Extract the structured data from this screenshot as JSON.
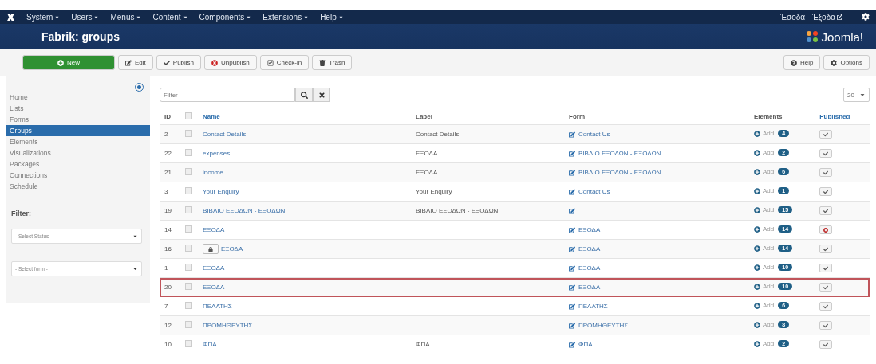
{
  "navbar": {
    "menus": [
      "System",
      "Users",
      "Menus",
      "Content",
      "Components",
      "Extensions",
      "Help"
    ],
    "user_link": "Έσοδα - Έξοδα"
  },
  "header": {
    "title": "Fabrik: groups",
    "logo_text": "Joomla!"
  },
  "toolbar": {
    "buttons": [
      {
        "kind": "new",
        "label": "New"
      },
      {
        "kind": "edit",
        "label": "Edit"
      },
      {
        "kind": "publish",
        "label": "Publish"
      },
      {
        "kind": "unpublish",
        "label": "Unpublish"
      },
      {
        "kind": "checkin",
        "label": "Check-in"
      },
      {
        "kind": "trash",
        "label": "Trash"
      }
    ],
    "right_buttons": [
      {
        "kind": "help",
        "label": "Help"
      },
      {
        "kind": "options",
        "label": "Options"
      }
    ]
  },
  "sidebar": {
    "items": [
      {
        "label": "Home",
        "selected": false
      },
      {
        "label": "Lists",
        "selected": false
      },
      {
        "label": "Forms",
        "selected": false
      },
      {
        "label": "Groups",
        "selected": true
      },
      {
        "label": "Elements",
        "selected": false
      },
      {
        "label": "Visualizations",
        "selected": false
      },
      {
        "label": "Packages",
        "selected": false
      },
      {
        "label": "Connections",
        "selected": false
      },
      {
        "label": "Schedule",
        "selected": false
      }
    ],
    "filter_title": "Filter:",
    "selects": [
      "- Select Status -",
      "- Select form -"
    ]
  },
  "search": {
    "placeholder": "Filter"
  },
  "page_size": "20",
  "table": {
    "select_all_checked": false,
    "columns": [
      "ID",
      "Name",
      "Label",
      "Form",
      "Elements",
      "Published"
    ],
    "rows": [
      {
        "id": "2",
        "name": "Contact Details",
        "label": "Contact Details",
        "form": "Contact Us",
        "add": "Add",
        "count": "4",
        "checked": false,
        "published": true,
        "locked": false,
        "highlighted": false
      },
      {
        "id": "22",
        "name": "expenses",
        "label": "ΕΞΟΔΑ",
        "form": "ΒΙΒΛΙΟ ΕΞΟΔΩΝ - ΕΞΟΔΩΝ",
        "add": "Add",
        "count": "2",
        "checked": false,
        "published": true,
        "locked": false,
        "highlighted": false
      },
      {
        "id": "21",
        "name": "income",
        "label": "ΕΞΟΔΑ",
        "form": "ΒΙΒΛΙΟ ΕΞΟΔΩΝ - ΕΞΟΔΩΝ",
        "add": "Add",
        "count": "6",
        "checked": false,
        "published": true,
        "locked": false,
        "highlighted": false
      },
      {
        "id": "3",
        "name": "Your Enquiry",
        "label": "Your Enquiry",
        "form": "Contact Us",
        "add": "Add",
        "count": "1",
        "checked": false,
        "published": true,
        "locked": false,
        "highlighted": false
      },
      {
        "id": "19",
        "name": "ΒΙΒΛΙΟ ΕΞΟΔΩΝ - ΕΞΟΔΩΝ",
        "label": "ΒΙΒΛΙΟ ΕΞΟΔΩΝ - ΕΞΟΔΩΝ",
        "form": "",
        "add": "Add",
        "count": "15",
        "checked": false,
        "published": true,
        "locked": false,
        "highlighted": false
      },
      {
        "id": "14",
        "name": "ΕΞΟΔΑ",
        "label": "",
        "form": "ΕΞΟΔΑ",
        "add": "Add",
        "count": "14",
        "checked": false,
        "published": false,
        "locked": false,
        "highlighted": false
      },
      {
        "id": "16",
        "name": "ΕΞΟΔΑ",
        "label": "",
        "form": "ΕΞΟΔΑ",
        "add": "Add",
        "count": "14",
        "checked": false,
        "published": true,
        "locked": true,
        "highlighted": false
      },
      {
        "id": "1",
        "name": "ΕΞΟΔΑ",
        "label": "",
        "form": "ΕΞΟΔΑ",
        "add": "Add",
        "count": "10",
        "checked": false,
        "published": true,
        "locked": false,
        "highlighted": false
      },
      {
        "id": "20",
        "name": "ΕΞΟΔΑ",
        "label": "",
        "form": "ΕΞΟΔΑ",
        "add": "Add",
        "count": "10",
        "checked": false,
        "published": true,
        "locked": false,
        "highlighted": true
      },
      {
        "id": "7",
        "name": "ΠΕΛΑΤΗΣ",
        "label": "",
        "form": "ΠΕΛΑΤΗΣ",
        "add": "Add",
        "count": "6",
        "checked": false,
        "published": true,
        "locked": false,
        "highlighted": false
      },
      {
        "id": "12",
        "name": "ΠΡΟΜΗΘΕΥΤΗΣ",
        "label": "",
        "form": "ΠΡΟΜΗΘΕΥΤΗΣ",
        "add": "Add",
        "count": "8",
        "checked": false,
        "published": true,
        "locked": false,
        "highlighted": false
      },
      {
        "id": "10",
        "name": "ΦΠΑ",
        "label": "ΦΠΑ",
        "form": "ΦΠΑ",
        "add": "Add",
        "count": "2",
        "checked": false,
        "published": true,
        "locked": false,
        "highlighted": false
      }
    ]
  }
}
